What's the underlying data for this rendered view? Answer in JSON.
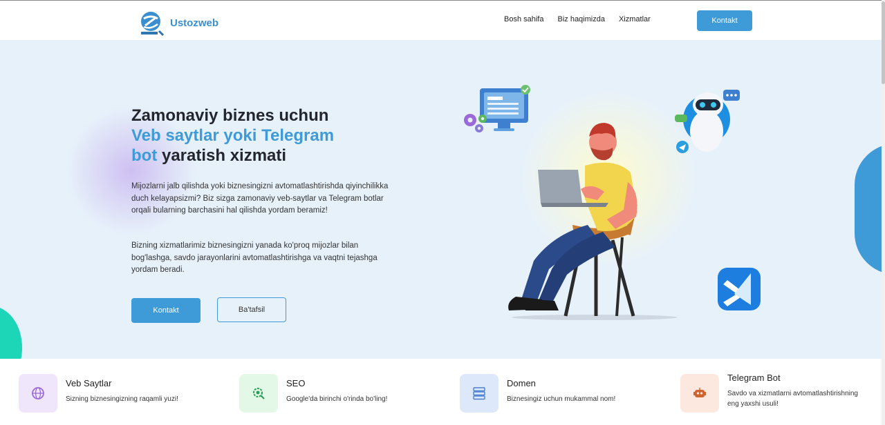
{
  "brand": {
    "name": "Ustozweb",
    "accent": "#3f9ad8"
  },
  "nav": [
    {
      "label": "Bosh sahifa"
    },
    {
      "label": "Biz haqimizda"
    },
    {
      "label": "Xizmatlar"
    }
  ],
  "header": {
    "contact_button": "Kontakt"
  },
  "hero": {
    "title_part1": "Zamonaviy biznes uchun",
    "title_highlight1": "Veb saytlar yoki Telegram",
    "title_highlight2": "bot",
    "title_part2": "yaratish xizmati",
    "paragraph1": "Mijozlarni jalb qilishda yoki biznesingizni avtomatlashtirishda qiyinchilikka duch kelayapsizmi? Biz sizga zamonaviy veb-saytlar va Telegram botlar orqali bularning barchasini hal qilishda yordam beramiz!",
    "paragraph2": "Bizning xizmatlarimiz biznesingizni yanada ko'proq mijozlar bilan bog'lashga, savdo jarayonlarini avtomatlashtirishga va vaqtni tejashga yordam beradi.",
    "primary_button": "Kontakt",
    "secondary_button": "Ba'tafsil"
  },
  "features": [
    {
      "title": "Veb Saytlar",
      "desc": "Sizning biznesingizning raqamli yuzi!",
      "icon": "globe-icon",
      "bg": "#efe6fb",
      "color": "#9b6ad8"
    },
    {
      "title": "SEO",
      "desc": "Google'da birinchi o'rinda bo'ling!",
      "icon": "seo-gear-icon",
      "bg": "#e3f8e6",
      "color": "#2a9d5a"
    },
    {
      "title": "Domen",
      "desc": "Biznesingiz uchun mukammal nom!",
      "icon": "server-icon",
      "bg": "#dde9fb",
      "color": "#4a7fd0"
    },
    {
      "title": "Telegram Bot",
      "desc": "Savdo va xizmatlarni avtomatlashtirishning eng yaxshi usuli!",
      "icon": "robot-icon",
      "bg": "#fde8df",
      "color": "#d0642d"
    }
  ]
}
